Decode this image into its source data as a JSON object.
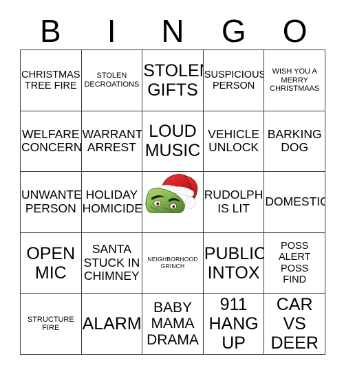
{
  "header": {
    "letters": [
      "B",
      "I",
      "N",
      "G",
      "O"
    ]
  },
  "card": {
    "columns": 5,
    "rows": 5,
    "border_color": "#3a3a3a",
    "background": "#ffffff",
    "text_color": "#000000"
  },
  "free_space": {
    "position": "row3-col3",
    "image": "grinch-santa-hat-image",
    "label": "NEIGHBORHOOD\nGRINCH",
    "colors": {
      "hat_red": "#d42426",
      "hat_fur_white": "#f7f7f7",
      "face_green_light": "#a8c96a",
      "face_green_mid": "#7fae4a",
      "face_green_dark": "#537f2e",
      "eye_white": "#ffffff",
      "eye_iris": "#8b1a1a",
      "outline_black": "#111111"
    }
  },
  "grid": {
    "rows": [
      [
        {
          "text": "CHRISTMAS\nTREE FIRE",
          "size": "fs-md"
        },
        {
          "text": "STOLEN\nDECROATIONS",
          "size": "fs-sm"
        },
        {
          "text": "STOLEN\nGIFTS",
          "size": "fs-xxl"
        },
        {
          "text": "SUSPICIOUS\nPERSON",
          "size": "fs-md"
        },
        {
          "text": "WISH YOU A\nMERRY\nCHRISTMAAS",
          "size": "fs-sm"
        }
      ],
      [
        {
          "text": "WELFARE\nCONCERN",
          "size": "fs-lg"
        },
        {
          "text": "WARRANT\nARREST",
          "size": "fs-lg"
        },
        {
          "text": "LOUD\nMUSIC",
          "size": "fs-xxl"
        },
        {
          "text": "VEHICLE\nUNLOCK",
          "size": "fs-lg"
        },
        {
          "text": "BARKING\nDOG",
          "size": "fs-lg"
        }
      ],
      [
        {
          "text": "UNWANTED\nPERSON",
          "size": "fs-lg"
        },
        {
          "text": "HOLIDAY\nHOMICIDE",
          "size": "fs-lg"
        },
        {
          "text": "",
          "size": "fs-xs",
          "free": true
        },
        {
          "text": "RUDOLPH\nIS LIT",
          "size": "fs-lg"
        },
        {
          "text": "DOMESTIC",
          "size": "fs-lg"
        }
      ],
      [
        {
          "text": "OPEN\nMIC",
          "size": "fs-xxl"
        },
        {
          "text": "SANTA\nSTUCK IN\nCHIMNEY",
          "size": "fs-lg"
        },
        {
          "text": "",
          "size": "fs-xs",
          "free_label_row": true
        },
        {
          "text": "PUBLIC\nINTOX",
          "size": "fs-xxl"
        },
        {
          "text": "POSS\nALERT\nPOSS\nFIND",
          "size": "fs-md"
        }
      ],
      [
        {
          "text": "STRUCTURE\nFIRE",
          "size": "fs-sm"
        },
        {
          "text": "ALARM",
          "size": "fs-xxl"
        },
        {
          "text": "BABY\nMAMA\nDRAMA",
          "size": "fs-xl"
        },
        {
          "text": "911\nHANG\nUP",
          "size": "fs-xxl"
        },
        {
          "text": "CAR\nVS\nDEER",
          "size": "fs-xxl"
        }
      ]
    ]
  }
}
